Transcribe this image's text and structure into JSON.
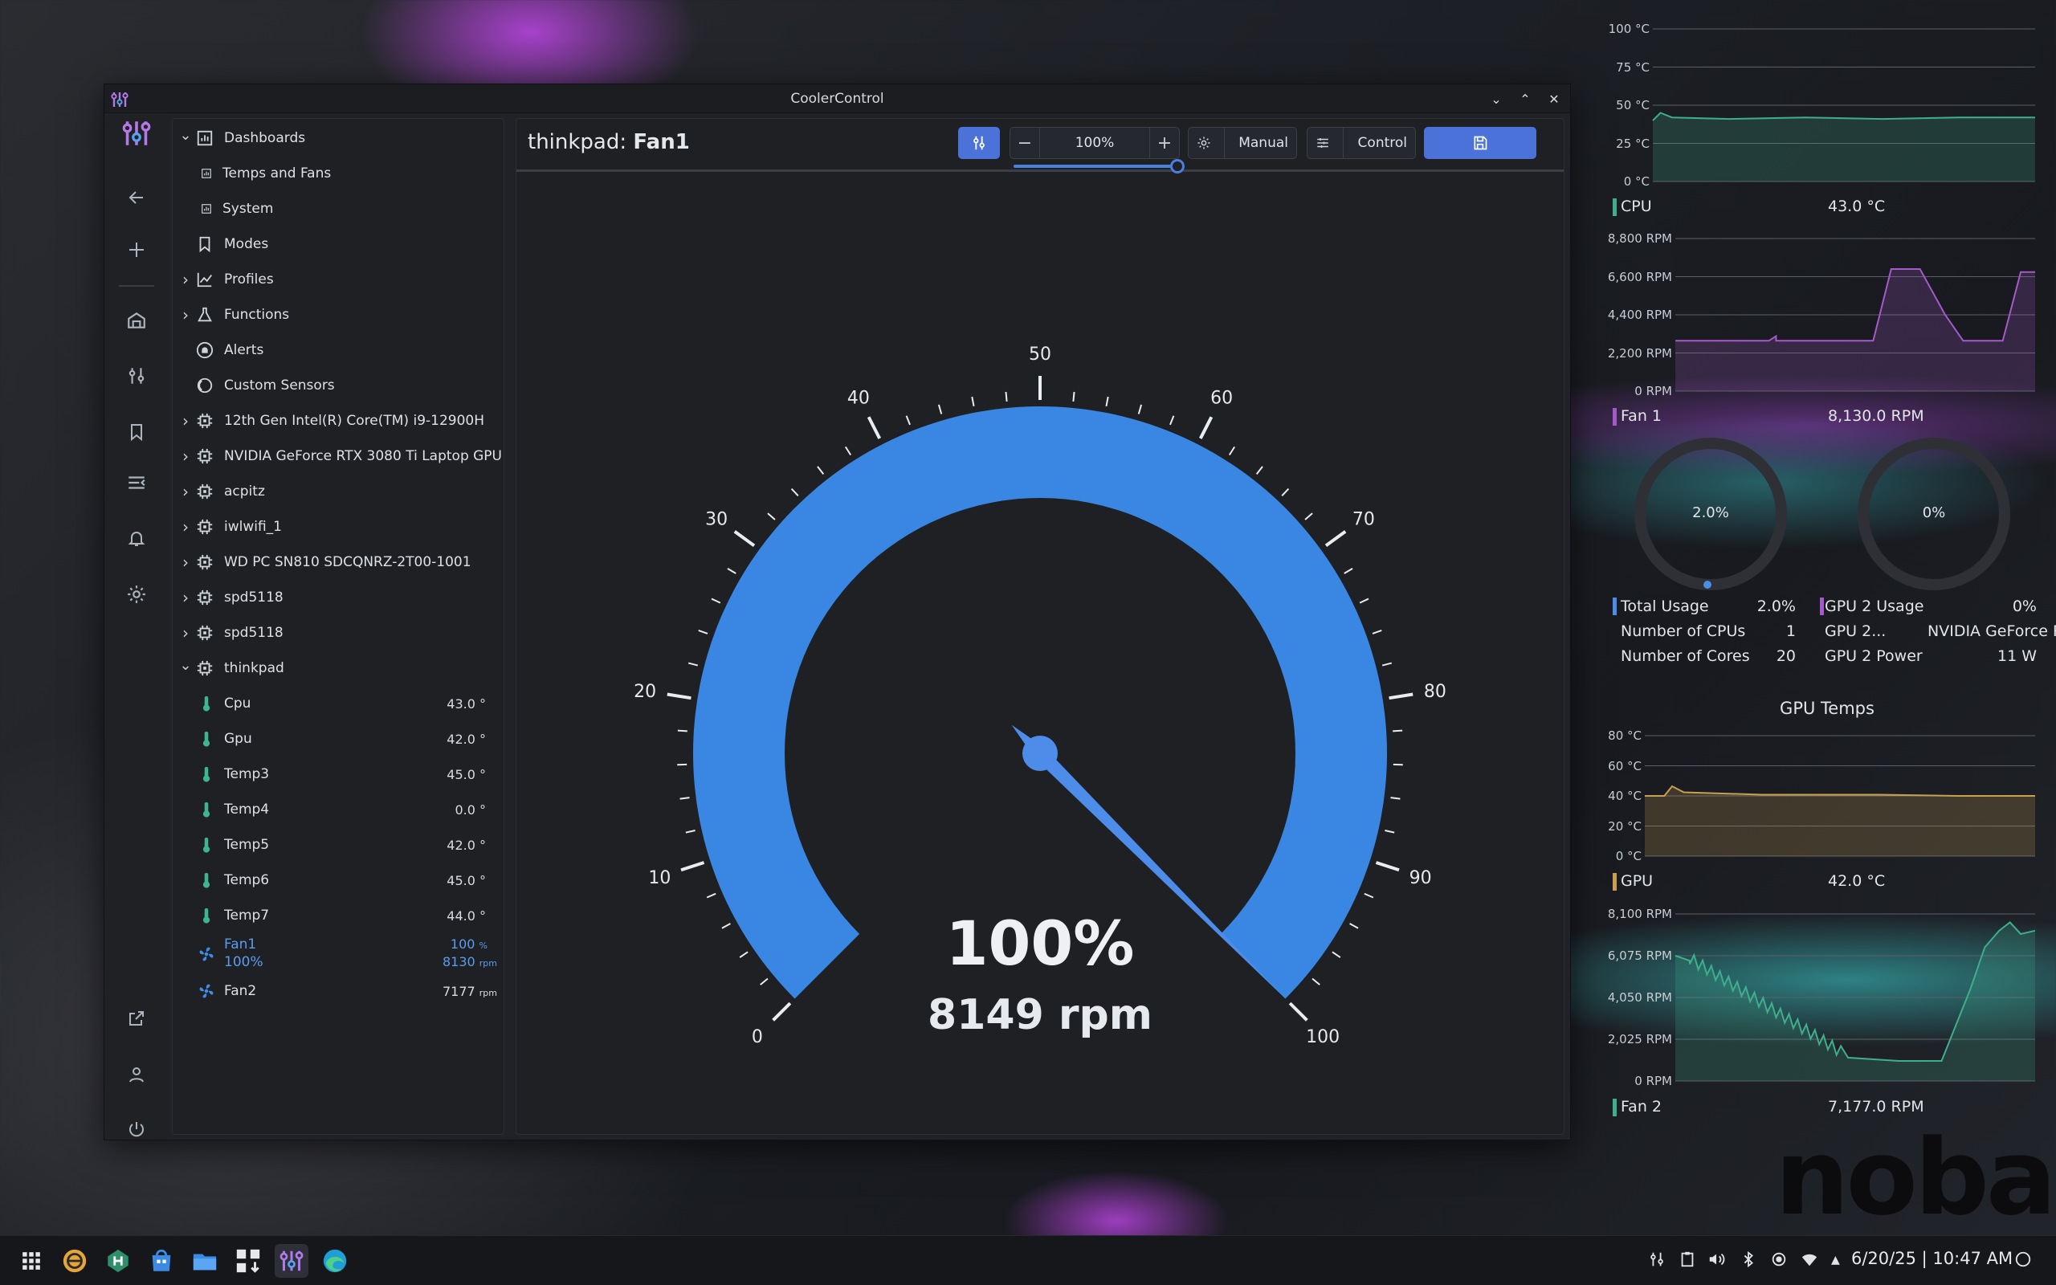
{
  "window": {
    "title": "CoolerControl"
  },
  "tree": {
    "items": [
      {
        "label": "Dashboards",
        "chev": "v",
        "icon": "dashboard",
        "indent": 0
      },
      {
        "label": "Temps and Fans",
        "chev": "",
        "icon": "chart-small",
        "indent": 1
      },
      {
        "label": "System",
        "chev": "",
        "icon": "chart-small",
        "indent": 1
      },
      {
        "label": "Modes",
        "chev": "",
        "icon": "bookmark",
        "indent": 0
      },
      {
        "label": "Profiles",
        "chev": ">",
        "icon": "profile",
        "indent": 0
      },
      {
        "label": "Functions",
        "chev": ">",
        "icon": "flask",
        "indent": 0
      },
      {
        "label": "Alerts",
        "chev": "",
        "icon": "alert",
        "indent": 0
      },
      {
        "label": "Custom Sensors",
        "chev": "",
        "icon": "circles",
        "indent": 0
      },
      {
        "label": "12th Gen Intel(R) Core(TM) i9-12900H",
        "chev": ">",
        "icon": "chip",
        "indent": 0
      },
      {
        "label": "NVIDIA GeForce RTX 3080 Ti Laptop GPU",
        "chev": ">",
        "icon": "chip",
        "indent": 0
      },
      {
        "label": "acpitz",
        "chev": ">",
        "icon": "chip",
        "indent": 0
      },
      {
        "label": "iwlwifi_1",
        "chev": ">",
        "icon": "chip",
        "indent": 0
      },
      {
        "label": "WD PC SN810 SDCQNRZ-2T00-1001",
        "chev": ">",
        "icon": "chip",
        "indent": 0
      },
      {
        "label": "spd5118",
        "chev": ">",
        "icon": "chip",
        "indent": 0
      },
      {
        "label": "spd5118",
        "chev": ">",
        "icon": "chip",
        "indent": 0
      },
      {
        "label": "thinkpad",
        "chev": "v",
        "icon": "chip",
        "indent": 0
      }
    ],
    "sensors": [
      {
        "label": "Cpu",
        "value": "43.0 °"
      },
      {
        "label": "Gpu",
        "value": "42.0 °"
      },
      {
        "label": "Temp3",
        "value": "45.0 °"
      },
      {
        "label": "Temp4",
        "value": "0.0 °"
      },
      {
        "label": "Temp5",
        "value": "42.0 °"
      },
      {
        "label": "Temp6",
        "value": "45.0 °"
      },
      {
        "label": "Temp7",
        "value": "44.0 °"
      }
    ],
    "fan1": {
      "label": "Fan1",
      "sub": "100%",
      "duty": "100",
      "duty_unit": "%",
      "rpm": "8130",
      "rpm_unit": "rpm"
    },
    "fan2": {
      "label": "Fan2",
      "rpm": "7177",
      "rpm_unit": "rpm"
    }
  },
  "header": {
    "device": "thinkpad: ",
    "channel": "Fan1",
    "zoom_value": "100%",
    "zoom_fraction": 1.0,
    "mode_label": "Manual",
    "control_label": "Control"
  },
  "gauge": {
    "value_percent": 100,
    "rpm": 8149,
    "big_text": "100%",
    "rpm_text": "8149 rpm",
    "ticks": [
      "0",
      "10",
      "20",
      "30",
      "40",
      "50",
      "60",
      "70",
      "80",
      "90",
      "100"
    ],
    "color": "#3a86e3"
  },
  "widgets": {
    "cpu_chart": {
      "ticks": [
        "100 °C",
        "75 °C",
        "50 °C",
        "25 °C",
        "0 °C"
      ],
      "legend": "CPU",
      "value": "43.0 °C",
      "color": "#3fae8c"
    },
    "fan1_chart": {
      "ticks": [
        "8,800 RPM",
        "6,600 RPM",
        "4,400 RPM",
        "2,200 RPM",
        "0 RPM"
      ],
      "legend": "Fan 1",
      "value": "8,130.0 RPM",
      "color": "#a45ac8"
    },
    "dials": [
      {
        "value": "2.0%"
      },
      {
        "value": "0%"
      }
    ],
    "stats_left": [
      {
        "label": "Total Usage",
        "value": "2.0%"
      },
      {
        "label": "Number of CPUs",
        "value": "1"
      },
      {
        "label": "Number of Cores",
        "value": "20"
      }
    ],
    "stats_right": [
      {
        "label": "GPU 2 Usage",
        "value": "0%"
      },
      {
        "label": "GPU 2...",
        "value": "NVIDIA GeForce RTX ..."
      },
      {
        "label": "GPU 2 Power",
        "value": "11 W"
      }
    ],
    "gpu_title": "GPU Temps",
    "gpu_chart": {
      "ticks": [
        "80 °C",
        "60 °C",
        "40 °C",
        "20 °C",
        "0 °C"
      ],
      "legend": "GPU",
      "value": "42.0 °C",
      "color": "#c8a050"
    },
    "fan2_chart": {
      "ticks": [
        "8,100 RPM",
        "6,075 RPM",
        "4,050 RPM",
        "2,025 RPM",
        "0 RPM"
      ],
      "legend": "Fan 2",
      "value": "7,177.0 RPM",
      "color": "#3fae8c"
    }
  },
  "taskbar": {
    "date": "6/20/25",
    "time": "10:47 AM"
  },
  "watermark": "nobar"
}
